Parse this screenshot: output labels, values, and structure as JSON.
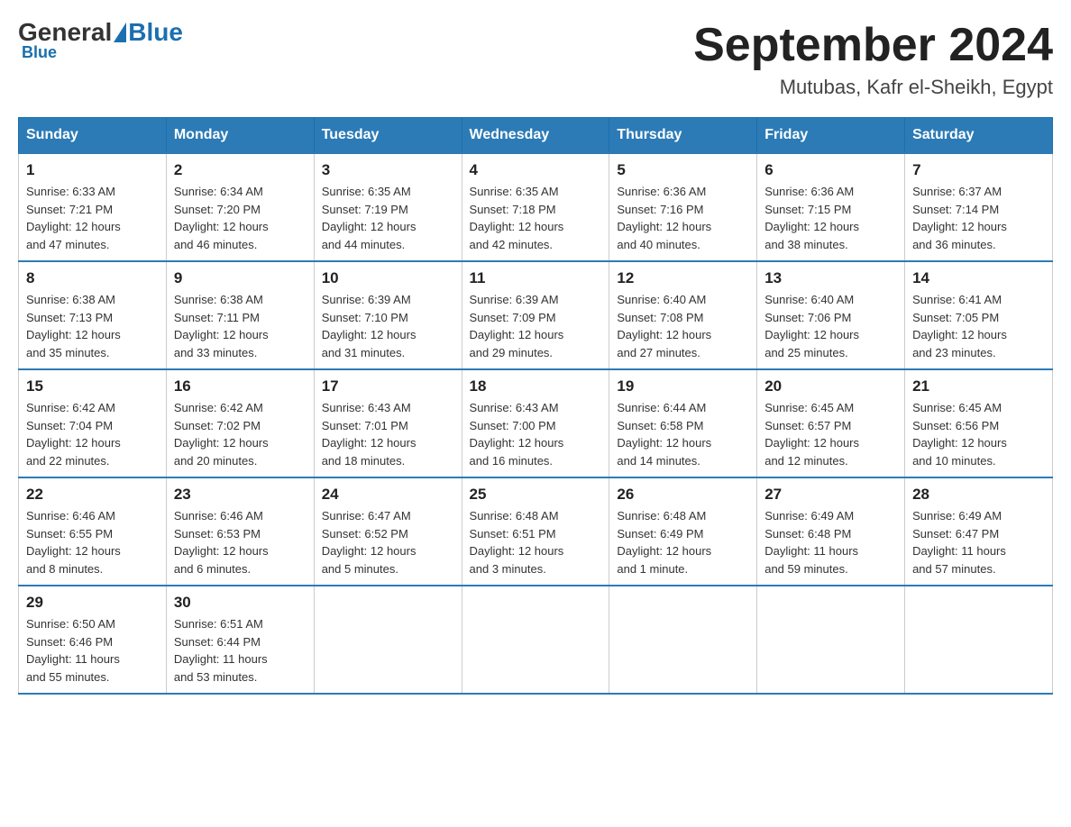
{
  "header": {
    "logo_general": "General",
    "logo_blue": "Blue",
    "month_title": "September 2024",
    "subtitle": "Mutubas, Kafr el-Sheikh, Egypt"
  },
  "days_of_week": [
    "Sunday",
    "Monday",
    "Tuesday",
    "Wednesday",
    "Thursday",
    "Friday",
    "Saturday"
  ],
  "weeks": [
    [
      {
        "day": "1",
        "sunrise": "6:33 AM",
        "sunset": "7:21 PM",
        "daylight": "12 hours and 47 minutes."
      },
      {
        "day": "2",
        "sunrise": "6:34 AM",
        "sunset": "7:20 PM",
        "daylight": "12 hours and 46 minutes."
      },
      {
        "day": "3",
        "sunrise": "6:35 AM",
        "sunset": "7:19 PM",
        "daylight": "12 hours and 44 minutes."
      },
      {
        "day": "4",
        "sunrise": "6:35 AM",
        "sunset": "7:18 PM",
        "daylight": "12 hours and 42 minutes."
      },
      {
        "day": "5",
        "sunrise": "6:36 AM",
        "sunset": "7:16 PM",
        "daylight": "12 hours and 40 minutes."
      },
      {
        "day": "6",
        "sunrise": "6:36 AM",
        "sunset": "7:15 PM",
        "daylight": "12 hours and 38 minutes."
      },
      {
        "day": "7",
        "sunrise": "6:37 AM",
        "sunset": "7:14 PM",
        "daylight": "12 hours and 36 minutes."
      }
    ],
    [
      {
        "day": "8",
        "sunrise": "6:38 AM",
        "sunset": "7:13 PM",
        "daylight": "12 hours and 35 minutes."
      },
      {
        "day": "9",
        "sunrise": "6:38 AM",
        "sunset": "7:11 PM",
        "daylight": "12 hours and 33 minutes."
      },
      {
        "day": "10",
        "sunrise": "6:39 AM",
        "sunset": "7:10 PM",
        "daylight": "12 hours and 31 minutes."
      },
      {
        "day": "11",
        "sunrise": "6:39 AM",
        "sunset": "7:09 PM",
        "daylight": "12 hours and 29 minutes."
      },
      {
        "day": "12",
        "sunrise": "6:40 AM",
        "sunset": "7:08 PM",
        "daylight": "12 hours and 27 minutes."
      },
      {
        "day": "13",
        "sunrise": "6:40 AM",
        "sunset": "7:06 PM",
        "daylight": "12 hours and 25 minutes."
      },
      {
        "day": "14",
        "sunrise": "6:41 AM",
        "sunset": "7:05 PM",
        "daylight": "12 hours and 23 minutes."
      }
    ],
    [
      {
        "day": "15",
        "sunrise": "6:42 AM",
        "sunset": "7:04 PM",
        "daylight": "12 hours and 22 minutes."
      },
      {
        "day": "16",
        "sunrise": "6:42 AM",
        "sunset": "7:02 PM",
        "daylight": "12 hours and 20 minutes."
      },
      {
        "day": "17",
        "sunrise": "6:43 AM",
        "sunset": "7:01 PM",
        "daylight": "12 hours and 18 minutes."
      },
      {
        "day": "18",
        "sunrise": "6:43 AM",
        "sunset": "7:00 PM",
        "daylight": "12 hours and 16 minutes."
      },
      {
        "day": "19",
        "sunrise": "6:44 AM",
        "sunset": "6:58 PM",
        "daylight": "12 hours and 14 minutes."
      },
      {
        "day": "20",
        "sunrise": "6:45 AM",
        "sunset": "6:57 PM",
        "daylight": "12 hours and 12 minutes."
      },
      {
        "day": "21",
        "sunrise": "6:45 AM",
        "sunset": "6:56 PM",
        "daylight": "12 hours and 10 minutes."
      }
    ],
    [
      {
        "day": "22",
        "sunrise": "6:46 AM",
        "sunset": "6:55 PM",
        "daylight": "12 hours and 8 minutes."
      },
      {
        "day": "23",
        "sunrise": "6:46 AM",
        "sunset": "6:53 PM",
        "daylight": "12 hours and 6 minutes."
      },
      {
        "day": "24",
        "sunrise": "6:47 AM",
        "sunset": "6:52 PM",
        "daylight": "12 hours and 5 minutes."
      },
      {
        "day": "25",
        "sunrise": "6:48 AM",
        "sunset": "6:51 PM",
        "daylight": "12 hours and 3 minutes."
      },
      {
        "day": "26",
        "sunrise": "6:48 AM",
        "sunset": "6:49 PM",
        "daylight": "12 hours and 1 minute."
      },
      {
        "day": "27",
        "sunrise": "6:49 AM",
        "sunset": "6:48 PM",
        "daylight": "11 hours and 59 minutes."
      },
      {
        "day": "28",
        "sunrise": "6:49 AM",
        "sunset": "6:47 PM",
        "daylight": "11 hours and 57 minutes."
      }
    ],
    [
      {
        "day": "29",
        "sunrise": "6:50 AM",
        "sunset": "6:46 PM",
        "daylight": "11 hours and 55 minutes."
      },
      {
        "day": "30",
        "sunrise": "6:51 AM",
        "sunset": "6:44 PM",
        "daylight": "11 hours and 53 minutes."
      },
      null,
      null,
      null,
      null,
      null
    ]
  ],
  "labels": {
    "sunrise": "Sunrise:",
    "sunset": "Sunset:",
    "daylight": "Daylight:"
  }
}
